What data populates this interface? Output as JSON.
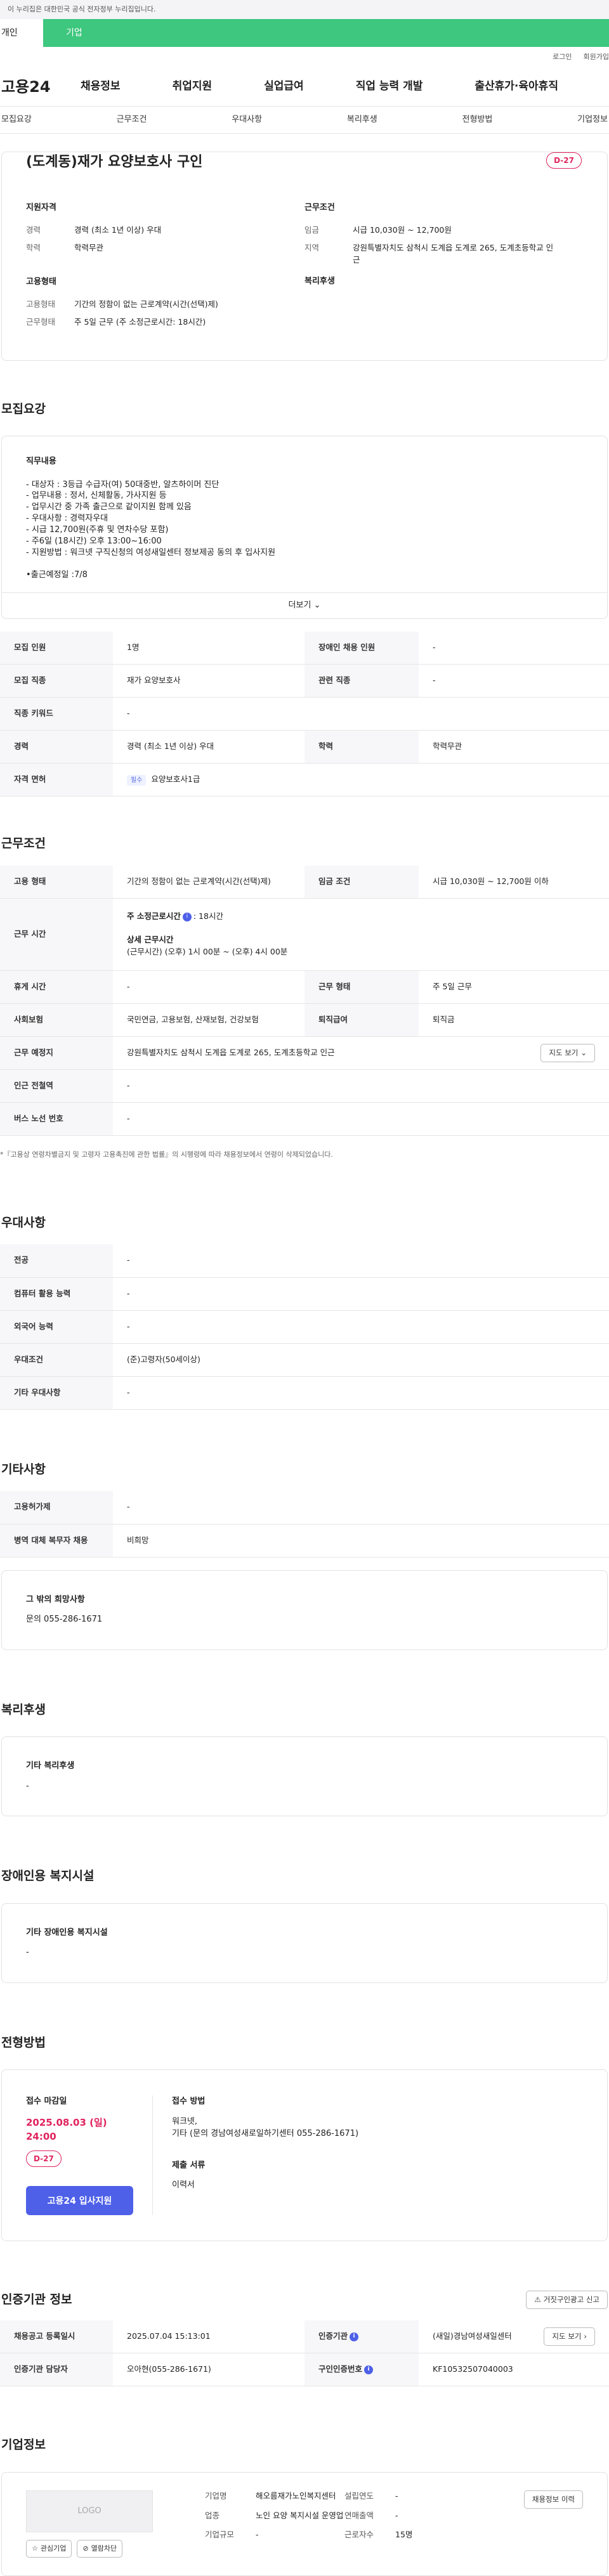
{
  "top_notice": "이 누리집은 대한민국 공식 전자정부 누리집입니다.",
  "tabs": {
    "personal": "개인",
    "company": "기업"
  },
  "util": {
    "login": "로그인",
    "signup": "회원가입"
  },
  "gnb": {
    "logo": "고용24",
    "items": [
      "채용정보",
      "취업지원",
      "실업급여",
      "직업 능력 개발",
      "출산휴가·육아휴직"
    ]
  },
  "subnav": [
    "모집요강",
    "근무조건",
    "우대사항",
    "복리후생",
    "전형방법",
    "기업정보"
  ],
  "summary": {
    "title": "(도계동)재가 요양보호사 구인",
    "dday": "D-27",
    "qual_title": "지원자격",
    "career_k": "경력",
    "career_v": "경력 (최소 1년 이상) 우대",
    "edu_k": "학력",
    "edu_v": "학력무관",
    "cond_title": "근무조건",
    "wage_k": "임금",
    "wage_v": "시급 10,030원 ~ 12,700원",
    "area_k": "지역",
    "area_v": "강원특별자치도 삼척시 도계읍 도계로 265, 도계초등학교 인근",
    "emp_title": "고용형태",
    "emptype_k": "고용형태",
    "emptype_v": "기간의 정함이 없는 근로계약(시간(선택)제)",
    "worktype_k": "근무형태",
    "worktype_v": "주 5일 근무 (주 소정근로시간: 18시간)",
    "welfare_title": "복리후생"
  },
  "recruit": {
    "section_title": "모집요강",
    "duty_title": "직무내용",
    "duty_lines": [
      "- 대상자 : 3등급 수급자(여) 50대중반, 알츠하이머 진단",
      "- 업무내용 : 정서, 신체활동, 가사지원 등",
      "- 업무시간 중 가족 출근으로 같이지원 함께 있음",
      "- 우대사항 : 경력자우대",
      "- 시급 12,700원(주휴 및 연차수당 포함)",
      "- 주6일 (18시간) 오후 13:00~16:00",
      "- 지원방법 : 워크넷 구직신청의 여성새일센터 정보제공 동의 후 입사지원",
      "",
      "•출근예정일 :7/8"
    ],
    "more": "더보기",
    "rows": {
      "num_k": "모집 인원",
      "num_v": "1명",
      "disabled_k": "장애인 채용 인원",
      "disabled_v": "-",
      "job_k": "모집 직종",
      "job_v": "재가 요양보호사",
      "related_k": "관련 직종",
      "related_v": "-",
      "keyword_k": "직종 키워드",
      "keyword_v": "-",
      "career_k": "경력",
      "career_v": "경력 (최소 1년 이상) 우대",
      "edu_k": "학력",
      "edu_v": "학력무관",
      "license_k": "자격 면허",
      "license_tag": "필수",
      "license_v": "요양보호사1급"
    }
  },
  "conditions": {
    "section_title": "근무조건",
    "emptype_k": "고용 형태",
    "emptype_v": "기간의 정함이 없는 근로계약(시간(선택)제)",
    "wage_k": "임금 조건",
    "wage_v": "시급 10,030원 ~ 12,700원 이하",
    "hours_k": "근무 시간",
    "weekly_label": "주 소정근로시간",
    "weekly_v": ": 18시간",
    "detail_label": "상세 근무시간",
    "detail_v": "(근무시간) (오후) 1시 00분 ~ (오후) 4시 00분",
    "holiday_k": "휴게 시간",
    "holiday_v": "-",
    "workform_k": "근무 형태",
    "workform_v": "주 5일 근무",
    "insurance_k": "사회보험",
    "insurance_v": "국민연금, 고용보험, 산재보험, 건강보험",
    "retire_k": "퇴직급여",
    "retire_v": "퇴직금",
    "place_k": "근무 예정지",
    "place_v": "강원특별자치도 삼척시 도계읍 도계로 265, 도계초등학교 인근",
    "map_btn": "지도 보기",
    "subway_k": "인근 전철역",
    "subway_v": "-",
    "bus_k": "버스 노선 번호",
    "bus_v": "-",
    "note": "*『고용상 연령차별금지 및 고령자 고용촉진에 관한 법률』의 시행령에 따라 채용정보에서 연령이 삭제되었습니다."
  },
  "prefer": {
    "section_title": "우대사항",
    "rows": [
      [
        "전공",
        "-"
      ],
      [
        "컴퓨터 활용 능력",
        "-"
      ],
      [
        "외국어 능력",
        "-"
      ],
      [
        "우대조건",
        "(준)고령자(50세이상)"
      ],
      [
        "기타 우대사항",
        "-"
      ]
    ]
  },
  "etc": {
    "section_title": "기타사항",
    "rows": [
      [
        "고용허가제",
        "-"
      ],
      [
        "병역 대체 복무자 채용",
        "비희망"
      ]
    ],
    "box_title": "그 밖의 희망사항",
    "box_v": "문의 055-286-1671"
  },
  "welfare": {
    "section_title": "복리후생",
    "box_title": "기타 복리후생",
    "box_v": "-"
  },
  "disabled": {
    "section_title": "장애인용 복지시설",
    "box_title": "기타 장애인용 복지시설",
    "box_v": "-"
  },
  "apply": {
    "section_title": "전형방법",
    "deadline_title": "접수 마감일",
    "deadline": "2025.08.03 (일) 24:00",
    "dday": "D-27",
    "apply_btn": "고용24 입사지원",
    "method_title": "접수 방법",
    "method_v1": "워크넷,",
    "method_v2": "기타 (문의 경남여성새로일하기센터 055-286-1671)",
    "docs_title": "제출 서류",
    "docs_v": "이력서"
  },
  "agency": {
    "section_title": "인증기관 정보",
    "report_btn": "거짓구인광고 신고",
    "reg_date_k": "채용공고 등록일시",
    "reg_date_v": "2025.07.04 15:13:01",
    "agency_k": "인증기관",
    "agency_v": "(새일)경남여성새일센터",
    "map_btn": "지도 보기",
    "manager_k": "인증기관 담당자",
    "manager_v": "오아현(055-286-1671)",
    "reqno_k": "구인인증번호",
    "reqno_v": "KF10532507040003"
  },
  "company": {
    "section_title": "기업정보",
    "logo": "LOGO",
    "btn_interest": "관심기업",
    "btn_block": "열람차단",
    "history_btn": "채용정보 이력",
    "name_k": "기업명",
    "name_v": "해오름재가노인복지센터",
    "industry_k": "업종",
    "industry_v": "노인 요양 복지시설 운영업",
    "size_k": "기업규모",
    "size_v": "-",
    "year_k": "설립연도",
    "year_v": "-",
    "sales_k": "연매출액",
    "sales_v": "-",
    "staff_k": "근로자수",
    "staff_v": "15명"
  }
}
